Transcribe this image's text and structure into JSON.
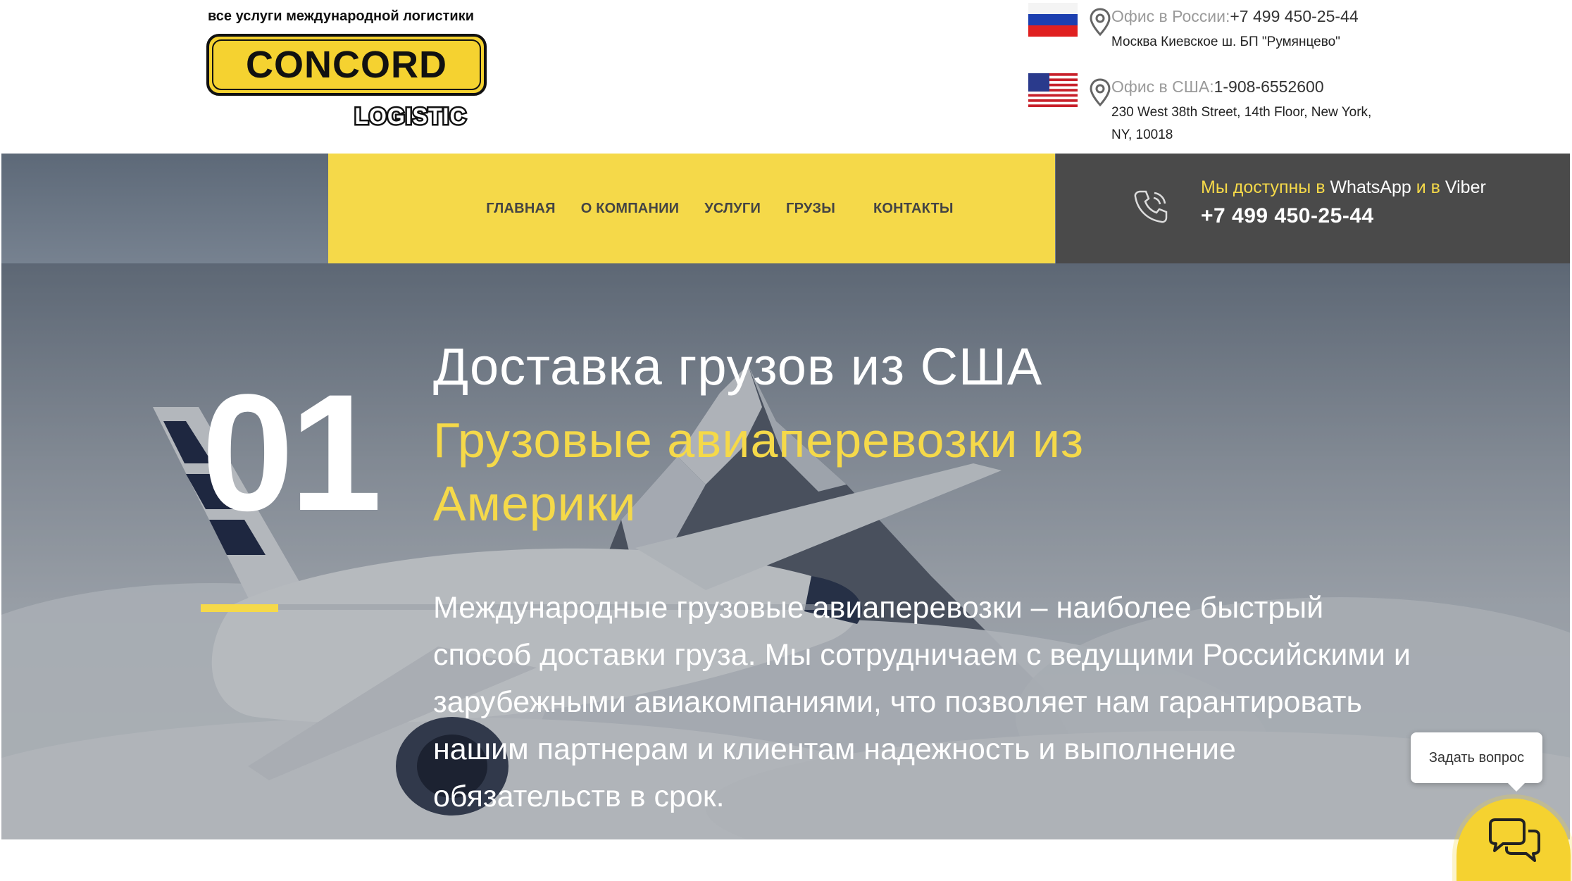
{
  "header": {
    "tagline": "все услуги международной логистики",
    "logo_text_main": "CONCORD",
    "logo_text_sub": "LOGISTIC",
    "offices": [
      {
        "label": "Офис в России:",
        "phone": "+7 499 450-25-44",
        "address_line1": "Москва Киевское ш. БП \"Румянцево\"",
        "address_line2": "",
        "flag": "russia-flag"
      },
      {
        "label": "Офис в США:",
        "phone": "1-908-6552600",
        "address_line1": "230 West 38th Street, 14th Floor, New York,",
        "address_line2": "NY, 10018",
        "flag": "usa-flag"
      }
    ]
  },
  "nav": {
    "items": [
      "Главная",
      "О компании",
      "Услуги",
      "Грузы",
      "Контакты"
    ]
  },
  "contact": {
    "available_prefix": "Мы доступны в ",
    "whatsapp": "WhatsApp",
    "available_mid": " и в ",
    "viber": "Viber",
    "phone": "+7 499 450-25-44",
    "icon": "phone-icon"
  },
  "hero": {
    "number": "01",
    "title": "Доставка грузов из США",
    "subtitle": "Грузовые авиаперевозки из Америки",
    "description": "Международные грузовые авиаперевозки – наиболее быстрый способ доставки груза. Мы сотрудничаем с ведущими Российскими и зарубежными авиакомпаниями, что позволяет нам гарантировать нашим партнерам и клиентам надежность и выполнение обязательств в срок."
  },
  "chat": {
    "tooltip": "Задать вопрос",
    "icon": "chat-bubbles-icon"
  },
  "colors": {
    "accent_yellow": "#f5d949",
    "dark_gray": "#4a4a4a",
    "text_white": "#ffffff"
  }
}
